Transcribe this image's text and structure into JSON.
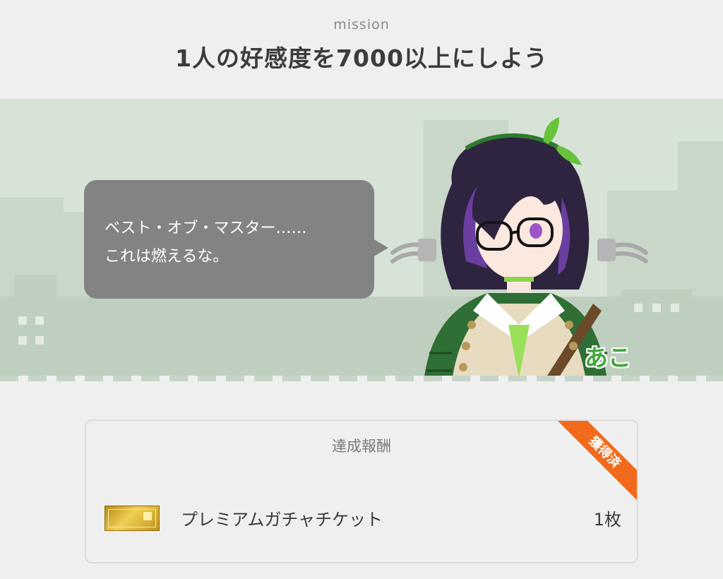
{
  "mission": {
    "label": "mission",
    "title": "1人の好感度を7000以上にしよう"
  },
  "dialogue": {
    "line1": "ベスト・オブ・マスター……",
    "line2": "これは燃えるな。",
    "speaker": "あこ"
  },
  "reward": {
    "heading": "達成報酬",
    "status": "獲得済",
    "item_name": "プレミアムガチャチケット",
    "item_count": "1枚",
    "item_icon": "premium-gacha-ticket-icon"
  },
  "colors": {
    "accent_orange": "#f26a1b",
    "speaker_green": "#41a53c",
    "bubble_gray": "#838383",
    "scene_green": "#d6e3d6"
  }
}
